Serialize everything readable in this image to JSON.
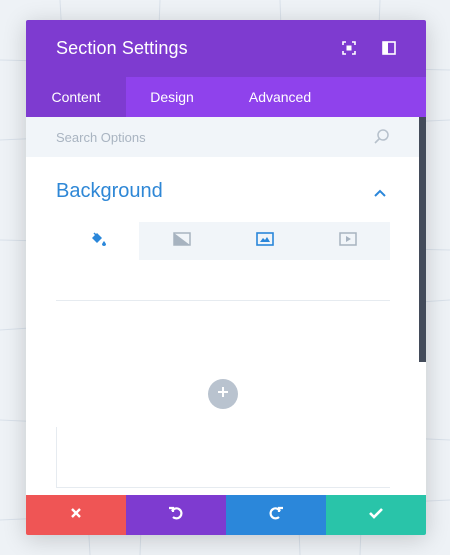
{
  "modal": {
    "title": "Section Settings"
  },
  "tabs": [
    {
      "label": "Content",
      "active": true
    },
    {
      "label": "Design",
      "active": false
    },
    {
      "label": "Advanced",
      "active": false
    }
  ],
  "search": {
    "placeholder": "Search Options",
    "icon": "search-icon"
  },
  "section": {
    "title": "Background",
    "expanded": true
  },
  "background_tabs": [
    {
      "icon": "paint-bucket-icon",
      "active": true
    },
    {
      "icon": "gradient-icon",
      "active": false
    },
    {
      "icon": "image-icon",
      "active": false
    },
    {
      "icon": "video-icon",
      "active": false
    }
  ],
  "footer": {
    "buttons": [
      "cancel",
      "undo",
      "redo",
      "save"
    ]
  },
  "colors": {
    "header": "#7e3bd0",
    "tabs": "#8f42ec",
    "accent_blue": "#2b87da",
    "cancel": "#ef5555",
    "save": "#29c4a9"
  }
}
